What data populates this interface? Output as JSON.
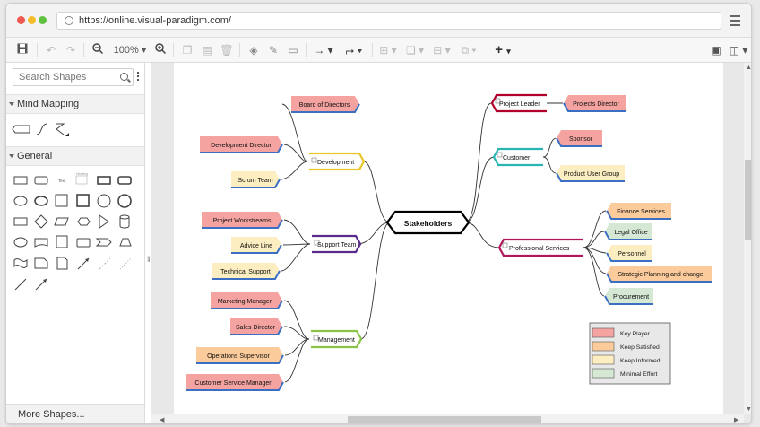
{
  "browser": {
    "url": "https://online.visual-paradigm.com/"
  },
  "toolbar": {
    "zoom": "100%"
  },
  "sidebar": {
    "search_placeholder": "Search Shapes",
    "sections": [
      "Mind Mapping",
      "General"
    ],
    "general_text_shape": "Text",
    "general_heading_shape": "Heading",
    "more_shapes": "More Shapes..."
  },
  "diagram": {
    "central": "Stakeholders",
    "branches": {
      "development": "Development",
      "support_team": "Support Team",
      "management": "Management",
      "project_leader": "Project Leader",
      "customer": "Customer",
      "professional_services": "Professional Services"
    },
    "leaves": {
      "board_of_directors": "Board of Directors",
      "development_director": "Development Director",
      "scrum_team": "Scrum Team",
      "project_workstreams": "Project Workstreams",
      "advice_line": "Advice Line",
      "technical_support": "Technical Support",
      "marketing_manager": "Marketing Manager",
      "sales_director": "Sales Director",
      "operations_supervisor": "Operations Supervisor",
      "customer_service_manager": "Customer Service Manager",
      "projects_director": "Projects Director",
      "sponsor": "Sponsor",
      "product_user_group": "Product User Group",
      "finance_services": "Finance Services",
      "legal_office": "Legal Office",
      "personnel": "Personnel",
      "strategic_planning": "Strategic Planning and change",
      "procurement": "Procurement"
    },
    "legend": {
      "key_player": "Key Player",
      "keep_satisfied": "Keep Satisfied",
      "keep_informed": "Keep Informed",
      "minimal_effort": "Minimal Effort"
    }
  },
  "colors": {
    "key_player": "#f4a3a0",
    "keep_satisfied": "#fbcb9b",
    "keep_informed": "#fdeec1",
    "minimal_effort": "#d5e8d4",
    "leaf_underline": "#3a6fc4",
    "branch_development": "#e6c62a",
    "branch_support": "#5a2a8c",
    "branch_management": "#8bc34a",
    "branch_project_leader": "#b0002a",
    "branch_customer": "#2ab5b5",
    "branch_professional": "#b0185a"
  }
}
